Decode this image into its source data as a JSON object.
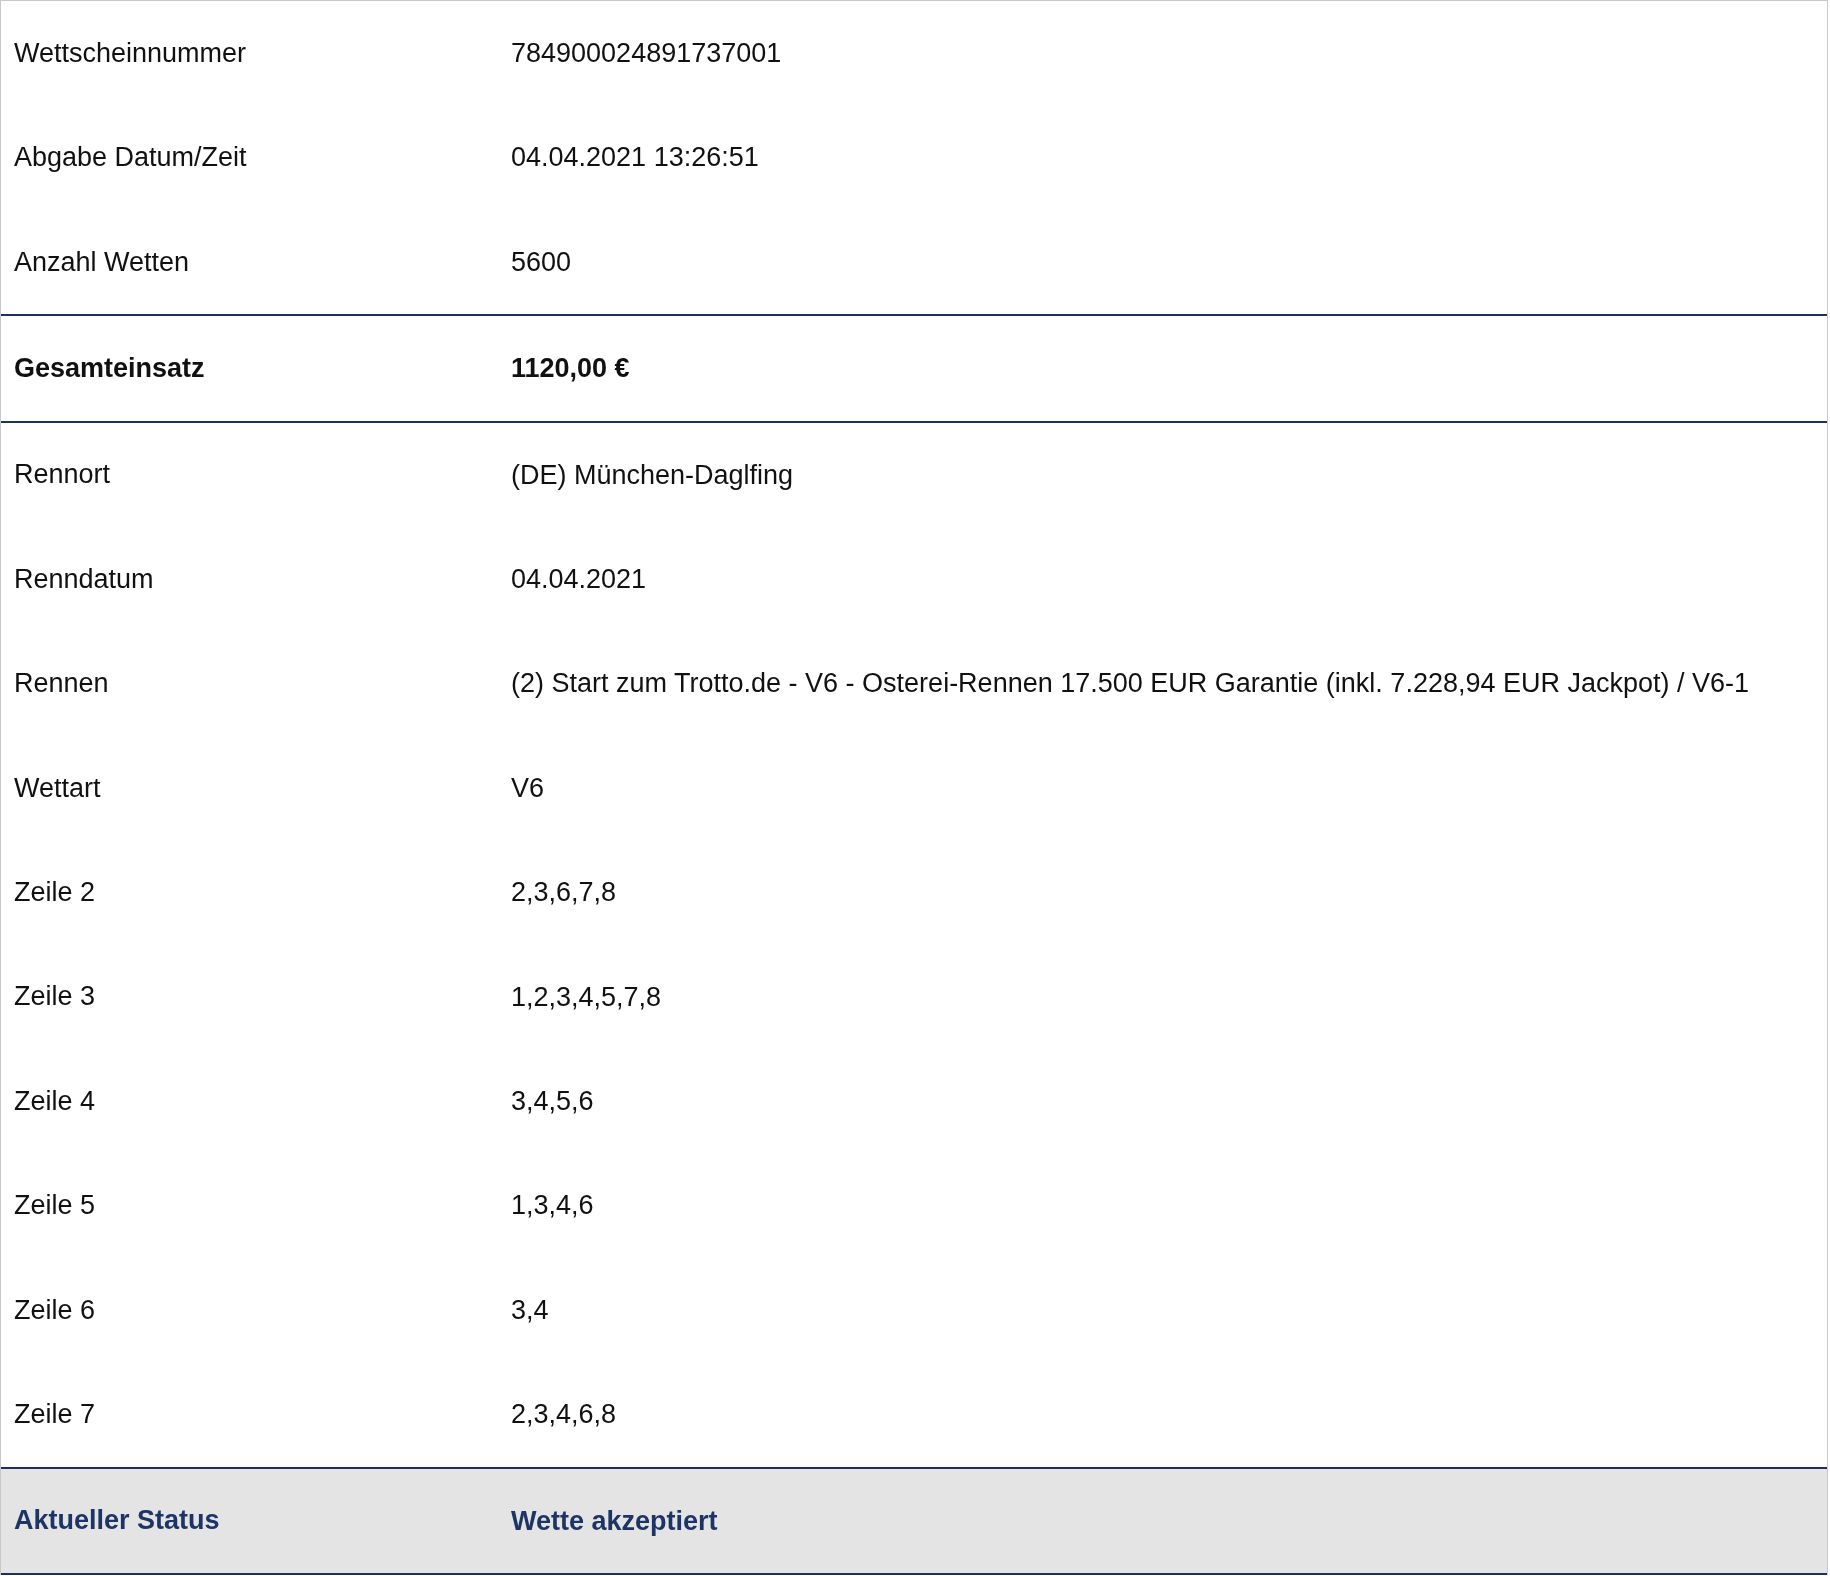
{
  "rows": [
    {
      "kind": "plain",
      "label": "Wettscheinnummer",
      "value": "784900024891737001"
    },
    {
      "kind": "plain",
      "label": "Abgabe Datum/Zeit",
      "value": "04.04.2021 13:26:51"
    },
    {
      "kind": "plain",
      "label": "Anzahl Wetten",
      "value": "5600"
    },
    {
      "kind": "total",
      "label": "Gesamteinsatz",
      "value": "1120,00 €"
    },
    {
      "kind": "plain",
      "label": "Rennort",
      "value": "(DE) München-Daglfing"
    },
    {
      "kind": "plain",
      "label": "Renndatum",
      "value": "04.04.2021"
    },
    {
      "kind": "plain",
      "label": "Rennen",
      "value": "(2) Start zum Trotto.de - V6 - Osterei-Rennen 17.500 EUR Garantie (inkl. 7.228,94 EUR Jackpot) / V6-1"
    },
    {
      "kind": "plain",
      "label": "Wettart",
      "value": "V6"
    },
    {
      "kind": "plain",
      "label": "Zeile 2",
      "value": "2,3,6,7,8"
    },
    {
      "kind": "plain",
      "label": "Zeile 3",
      "value": "1,2,3,4,5,7,8"
    },
    {
      "kind": "plain",
      "label": "Zeile 4",
      "value": "3,4,5,6"
    },
    {
      "kind": "plain",
      "label": "Zeile 5",
      "value": "1,3,4,6"
    },
    {
      "kind": "plain",
      "label": "Zeile 6",
      "value": "3,4"
    },
    {
      "kind": "plain",
      "label": "Zeile 7",
      "value": "2,3,4,6,8"
    },
    {
      "kind": "status",
      "label": "Aktueller Status",
      "value": "Wette akzeptiert"
    }
  ]
}
